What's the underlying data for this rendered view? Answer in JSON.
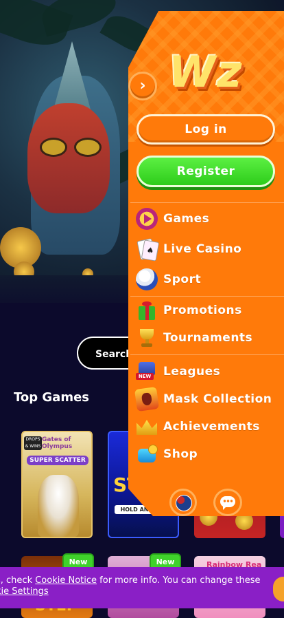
{
  "background": {
    "search_label": "Search",
    "section_title": "Top Games",
    "games": [
      {
        "title": "Gates of Olympus",
        "tag": "SUPER SCATTER",
        "badge": "DROPS & WINS"
      },
      {
        "title": "STI",
        "tag": "HOLD AND WIN"
      },
      {
        "title": ""
      }
    ],
    "games_row2": [
      {
        "text": "STEP",
        "badge": "New"
      },
      {
        "text": "",
        "badge": "New"
      },
      {
        "text": "Rainbow Rea",
        "badge": ""
      }
    ]
  },
  "cookie": {
    "line1_prefix": "s, check ",
    "link_notice": "Cookie Notice",
    "line1_suffix": " for more info. You can change these",
    "link_settings": "kie Settings"
  },
  "menu": {
    "logo": "Wz",
    "login_label": "Log in",
    "register_label": "Register",
    "items": [
      {
        "label": "Games",
        "icon": "play-icon"
      },
      {
        "label": "Live Casino",
        "icon": "cards-icon"
      },
      {
        "label": "Sport",
        "icon": "ball-icon"
      },
      {
        "label": "Promotions",
        "icon": "gift-icon"
      },
      {
        "label": "Tournaments",
        "icon": "trophy-icon"
      },
      {
        "label": "Leagues",
        "icon": "leagues-icon",
        "badge": "NEW"
      },
      {
        "label": "Mask Collection",
        "icon": "mask-icon"
      },
      {
        "label": "Achievements",
        "icon": "crown-icon"
      },
      {
        "label": "Shop",
        "icon": "bag-icon"
      }
    ]
  },
  "colors": {
    "menu_bg": "#ff7a0a",
    "register_green": "#3ad925",
    "cookie_bg": "#8a1fc6",
    "page_bg": "#0c0a2c"
  }
}
